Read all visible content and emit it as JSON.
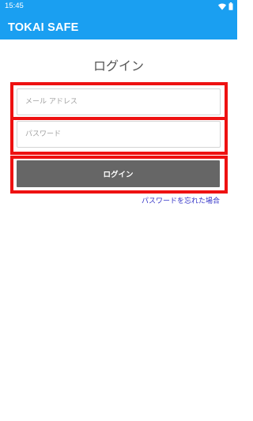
{
  "status_bar": {
    "time": "15:45",
    "icons": [
      "wifi-icon",
      "battery-icon"
    ]
  },
  "app_bar": {
    "title": "TOKAI SAFE"
  },
  "login_form": {
    "heading": "ログイン",
    "email": {
      "value": "",
      "placeholder": "メール アドレス"
    },
    "password": {
      "value": "",
      "placeholder": "パスワード"
    },
    "submit_label": "ログイン",
    "forgot_password_label": "パスワードを忘れた場合"
  },
  "colors": {
    "app_bar": "#1a9ff1",
    "highlight": "#ee1111",
    "button": "#666666",
    "link": "#3434c8"
  }
}
